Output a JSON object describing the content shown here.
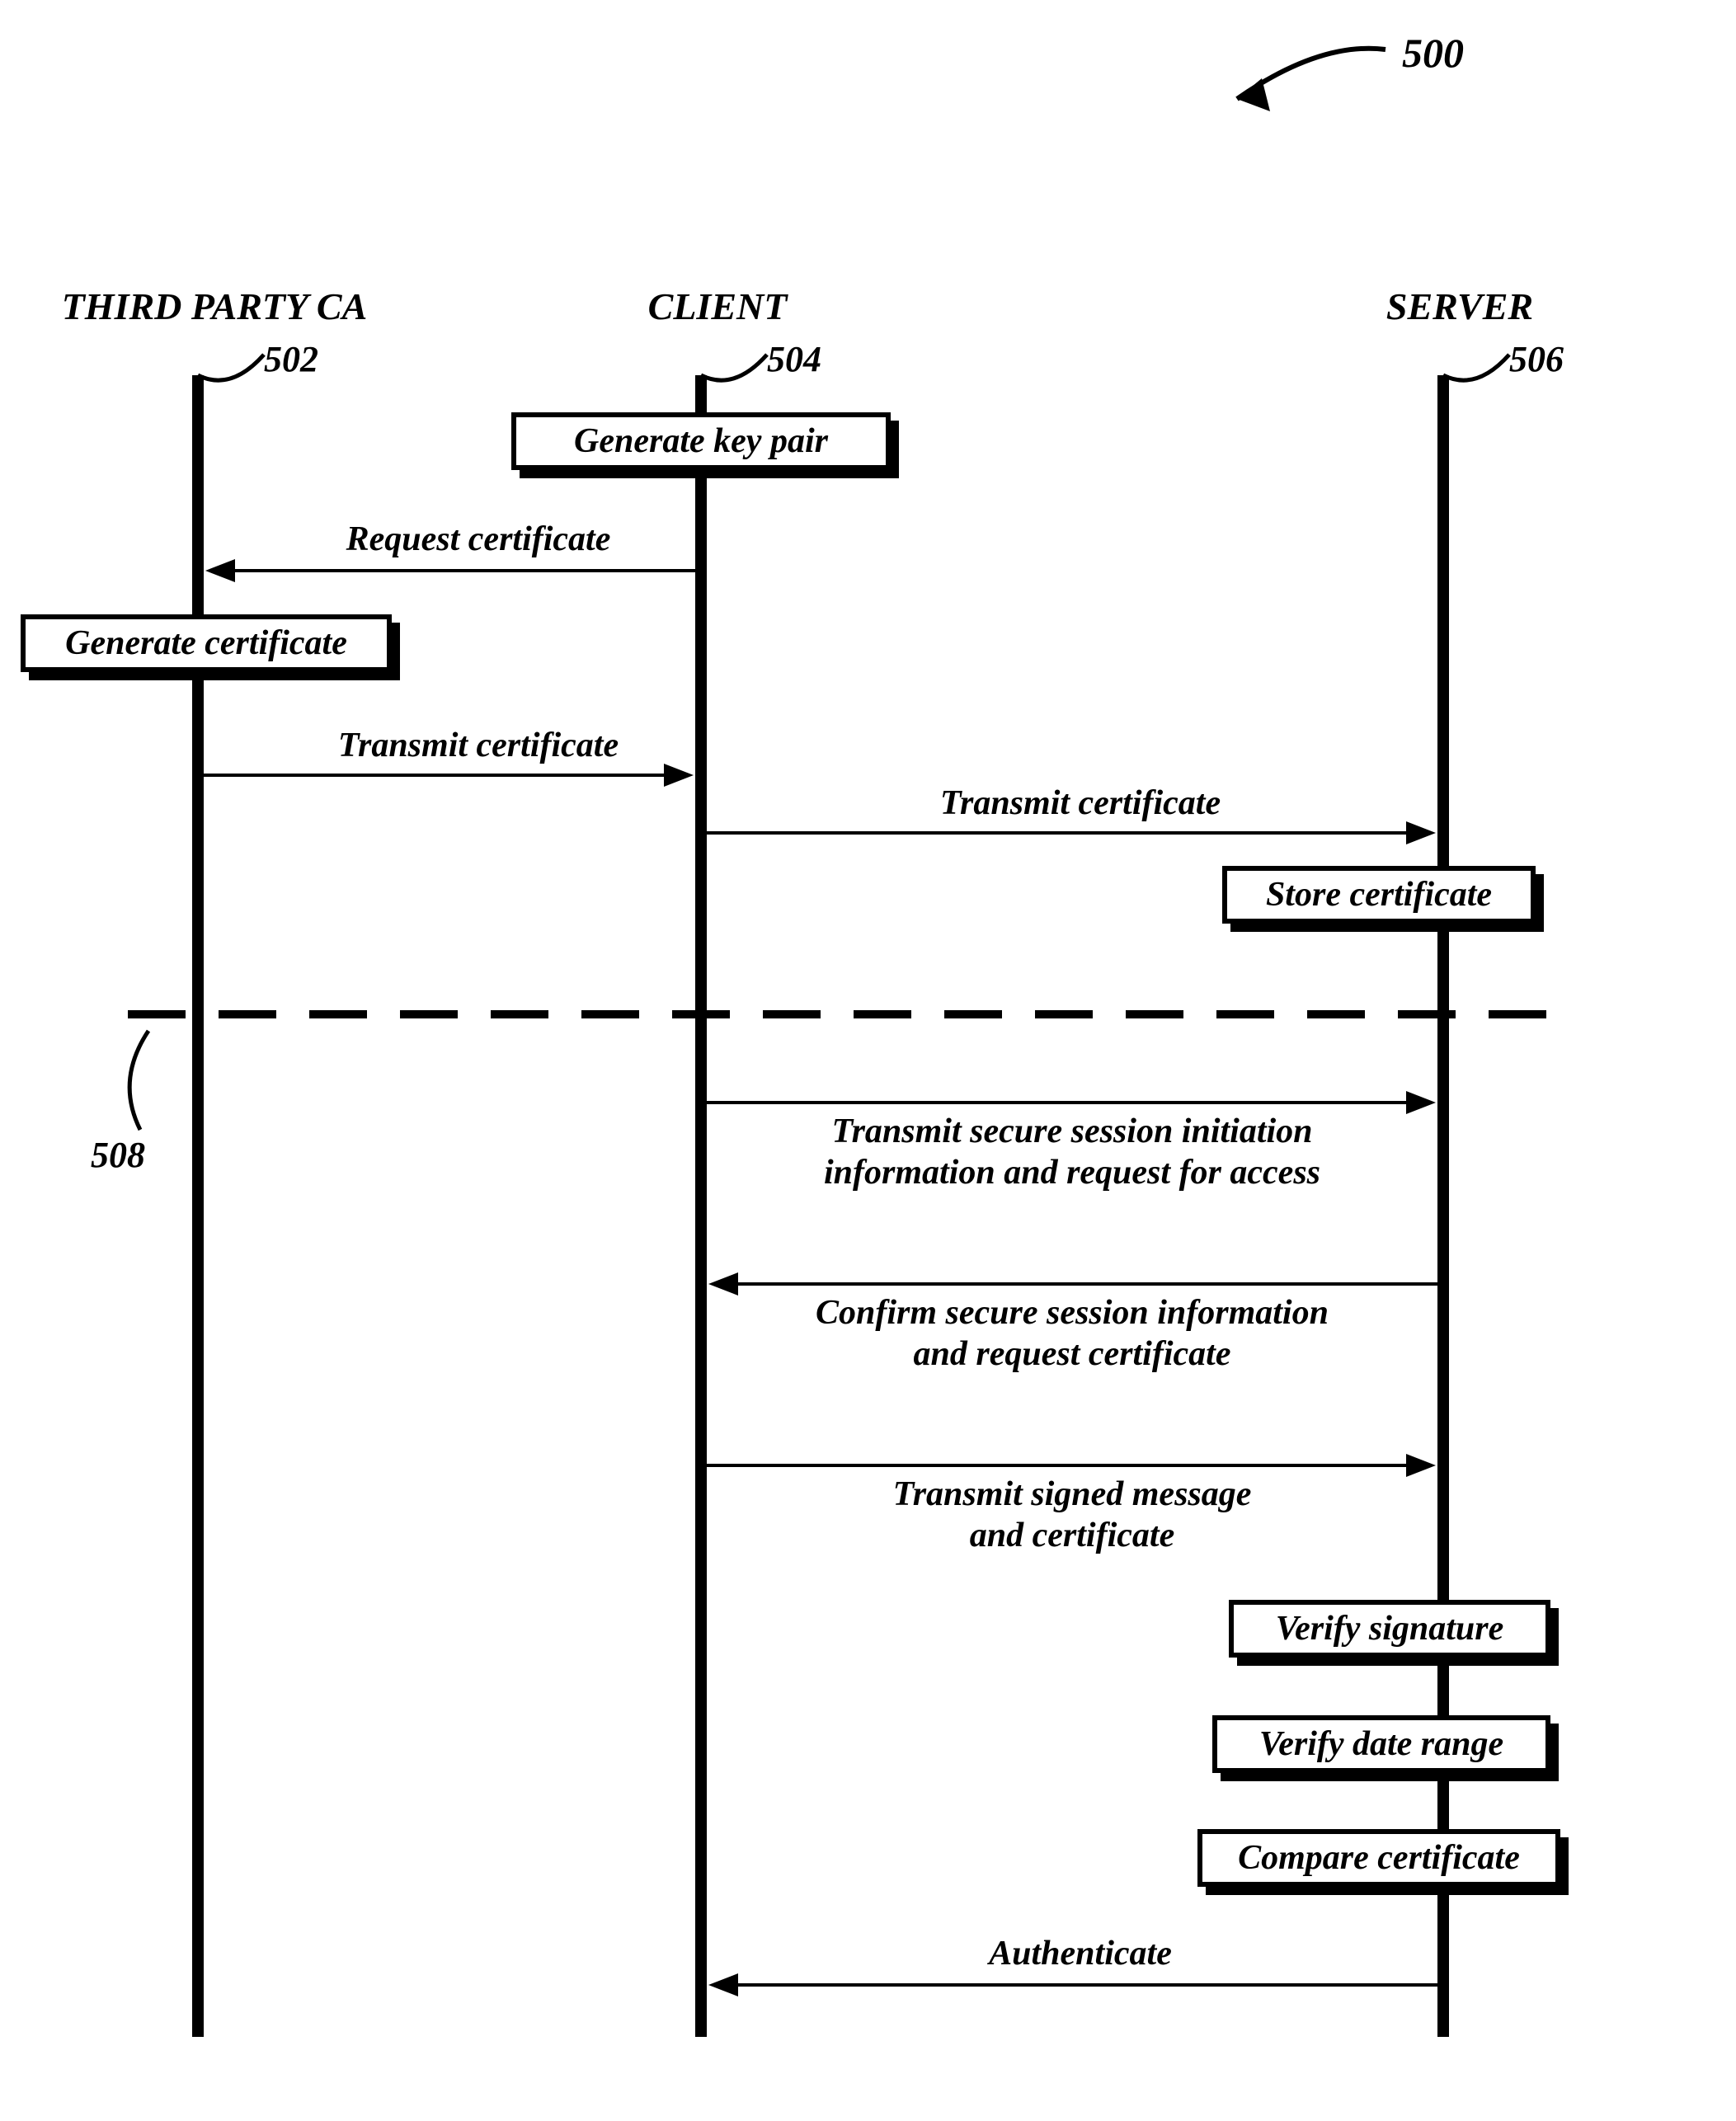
{
  "figure_ref": "500",
  "participants": {
    "third_party_ca": {
      "label": "THIRD PARTY CA",
      "ref": "502"
    },
    "client": {
      "label": "CLIENT",
      "ref": "504"
    },
    "server": {
      "label": "SERVER",
      "ref": "506"
    }
  },
  "divider_ref": "508",
  "boxes": {
    "gen_key_pair": "Generate key pair",
    "gen_certificate": "Generate certificate",
    "store_cert": "Store certificate",
    "verify_sig": "Verify signature",
    "verify_date": "Verify date range",
    "compare_cert": "Compare certificate"
  },
  "messages": {
    "request_cert": "Request certificate",
    "transmit_cert_1": "Transmit certificate",
    "transmit_cert_2": "Transmit certificate",
    "session_init_l1": "Transmit secure session initiation",
    "session_init_l2": "information and request for access",
    "confirm_l1": "Confirm secure session information",
    "confirm_l2": "and request certificate",
    "signed_l1": "Transmit signed message",
    "signed_l2": "and certificate",
    "authenticate": "Authenticate"
  }
}
